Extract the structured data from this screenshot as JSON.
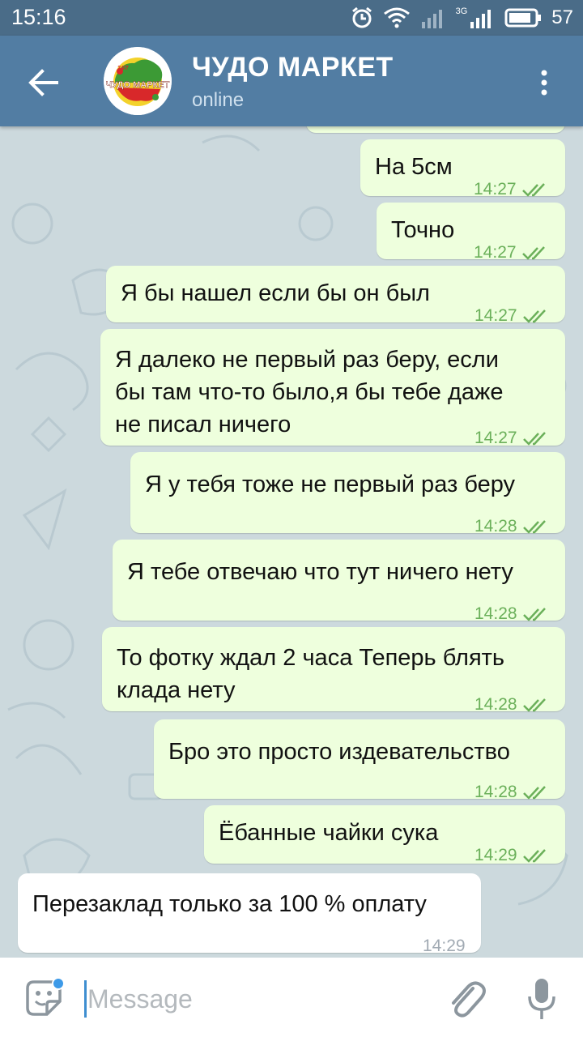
{
  "status_bar": {
    "time": "15:16",
    "network": "3G",
    "battery": "57"
  },
  "header": {
    "title": "ЧУДО МАРКЕТ",
    "status": "online",
    "avatar_text": "ЧУДО МАРКЕТ",
    "avatar_badge": "24/7"
  },
  "messages": [
    {
      "direction": "out",
      "lines": [
        "На 5см"
      ],
      "time": "14:27",
      "read": true
    },
    {
      "direction": "out",
      "lines": [
        "Точно"
      ],
      "time": "14:27",
      "read": true
    },
    {
      "direction": "out",
      "lines": [
        "Я бы нашел если бы он был"
      ],
      "time": "14:27",
      "read": true
    },
    {
      "direction": "out",
      "lines": [
        "Я далеко не первый раз беру, если",
        "бы там что-то было,я бы тебе даже",
        "не писал ничего"
      ],
      "time": "14:27",
      "read": true
    },
    {
      "direction": "out",
      "lines": [
        "Я у тебя тоже не первый раз беру"
      ],
      "time": "14:28",
      "read": true
    },
    {
      "direction": "out",
      "lines": [
        "Я тебе отвечаю что тут ничего нету"
      ],
      "time": "14:28",
      "read": true
    },
    {
      "direction": "out",
      "lines": [
        "То фотку ждал 2 часа Теперь блять",
        "клада нету"
      ],
      "time": "14:28",
      "read": true
    },
    {
      "direction": "out",
      "lines": [
        "Бро это просто издевательство"
      ],
      "time": "14:28",
      "read": true
    },
    {
      "direction": "out",
      "lines": [
        "Ёбанные чайки сука"
      ],
      "time": "14:29",
      "read": true
    },
    {
      "direction": "in",
      "lines": [
        "Перезаклад только за 100 % оплату"
      ],
      "time": "14:29"
    }
  ],
  "input": {
    "placeholder": "Message",
    "value": ""
  },
  "icons": {
    "back": "arrow-left-icon",
    "menu": "more-vert-icon",
    "sticker": "sticker-icon",
    "attach": "paperclip-icon",
    "mic": "microphone-icon",
    "read": "double-check-icon"
  },
  "colors": {
    "header": "#527da3",
    "status_bar": "#4a6c88",
    "outgoing_bubble": "#eeffdd",
    "incoming_bubble": "#ffffff",
    "check": "#6bb05a",
    "wallpaper": "#ccd9dd"
  }
}
